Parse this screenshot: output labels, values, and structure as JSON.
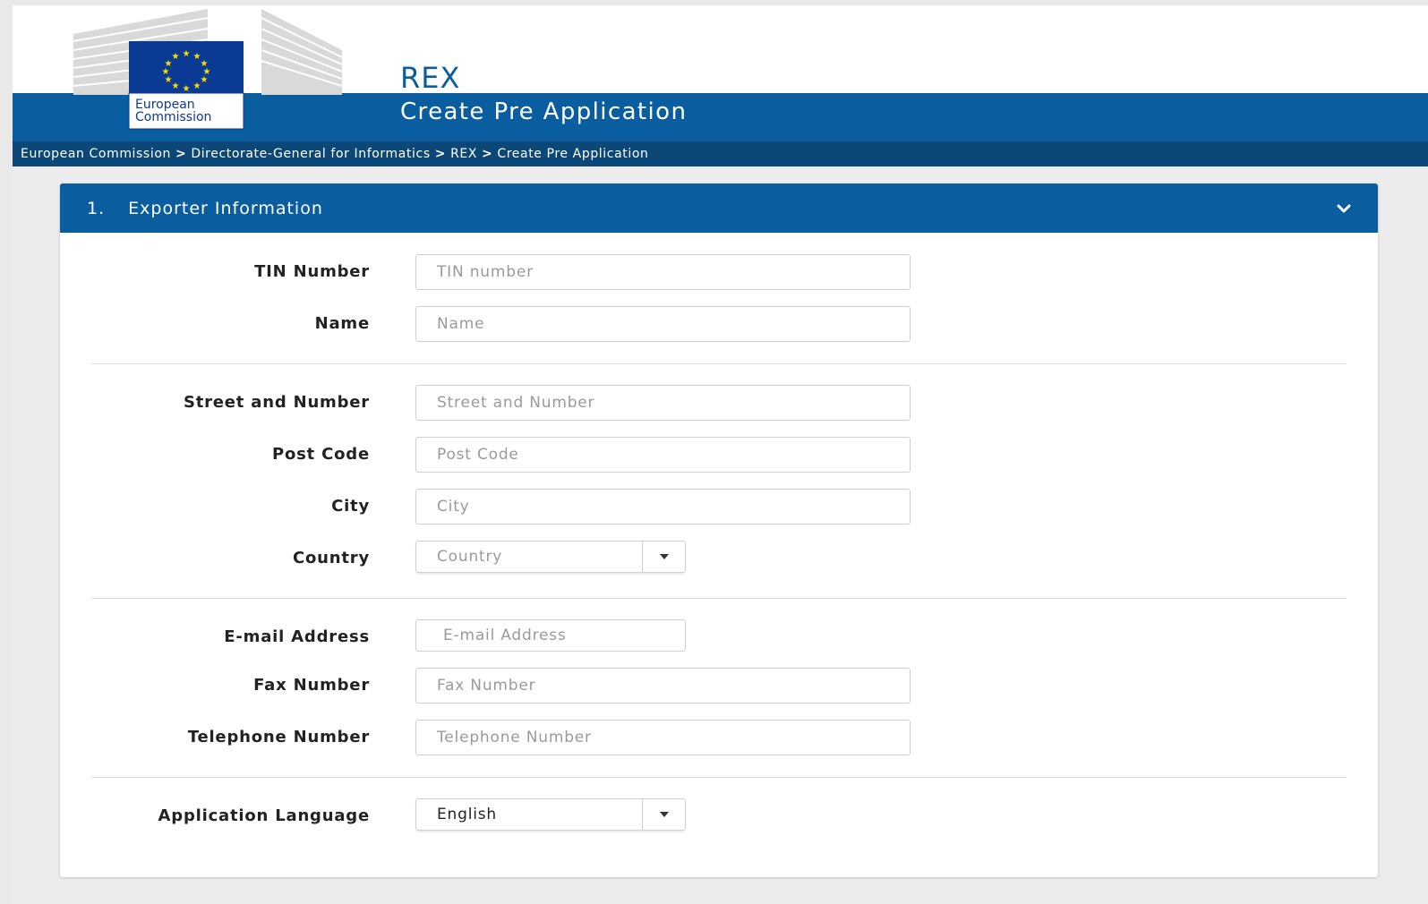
{
  "header": {
    "logo_line1": "European",
    "logo_line2": "Commission",
    "app_title": "REX",
    "page_title": "Create Pre Application"
  },
  "breadcrumb": [
    "European Commission",
    "Directorate-General for Informatics",
    "REX",
    "Create Pre Application"
  ],
  "panel": {
    "number": "1.",
    "title": "Exporter Information"
  },
  "form": {
    "tin": {
      "label": "TIN Number",
      "placeholder": "TIN number",
      "value": ""
    },
    "name": {
      "label": "Name",
      "placeholder": "Name",
      "value": ""
    },
    "street": {
      "label": "Street and Number",
      "placeholder": "Street and Number",
      "value": ""
    },
    "postcode": {
      "label": "Post Code",
      "placeholder": "Post Code",
      "value": ""
    },
    "city": {
      "label": "City",
      "placeholder": "City",
      "value": ""
    },
    "country": {
      "label": "Country",
      "placeholder": "Country"
    },
    "email": {
      "label": "E-mail Address",
      "placeholder": "E-mail Address",
      "value": ""
    },
    "fax": {
      "label": "Fax Number",
      "placeholder": "Fax Number",
      "value": ""
    },
    "telephone": {
      "label": "Telephone Number",
      "placeholder": "Telephone Number",
      "value": ""
    },
    "language": {
      "label": "Application Language",
      "selected": "English"
    }
  },
  "colors": {
    "brand_blue": "#0a5d9e",
    "breadcrumb_bg": "#0b4877",
    "eu_flag_blue": "#0a3a94",
    "eu_star_yellow": "#ffde00"
  },
  "icons": {
    "panel_toggle": "chevron-down-icon",
    "dropdown": "caret-down-icon"
  }
}
